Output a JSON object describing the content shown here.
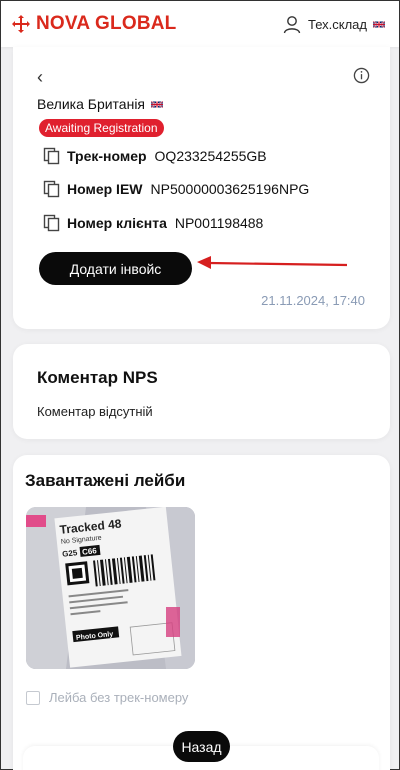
{
  "header": {
    "brand": "NOVA GLOBAL",
    "user_label": "Тех.склад",
    "brand_color": "#da291c"
  },
  "shipment": {
    "country": "Велика Британія",
    "status": "Awaiting Registration",
    "status_color": "#e0202e",
    "fields": [
      {
        "label": "Трек-номер",
        "value": "OQ233254255GB"
      },
      {
        "label": "Номер IEW",
        "value": "NP50000003625196NPG"
      },
      {
        "label": "Номер клієнта",
        "value": "NP001198488"
      }
    ],
    "add_invoice_label": "Додати інвойс",
    "datetime": "21.11.2024, 17:40"
  },
  "comment": {
    "title": "Коментар NPS",
    "text": "Коментар відсутній"
  },
  "labels": {
    "title": "Завантажені лейби",
    "image_text": {
      "service": "Tracked 48",
      "signature": "No Signature",
      "codes": [
        "G25",
        "C66"
      ],
      "photo_only": "Photo Only"
    },
    "no_track_checkbox": "Лейба без трек-номеру"
  },
  "footer": {
    "back_label": "Назад"
  },
  "icons": {
    "user": "user-icon",
    "flag": "uk-flag-icon",
    "back": "chevron-left-icon",
    "info": "info-icon",
    "copy": "copy-icon",
    "annotation": "red-arrow-annotation"
  }
}
